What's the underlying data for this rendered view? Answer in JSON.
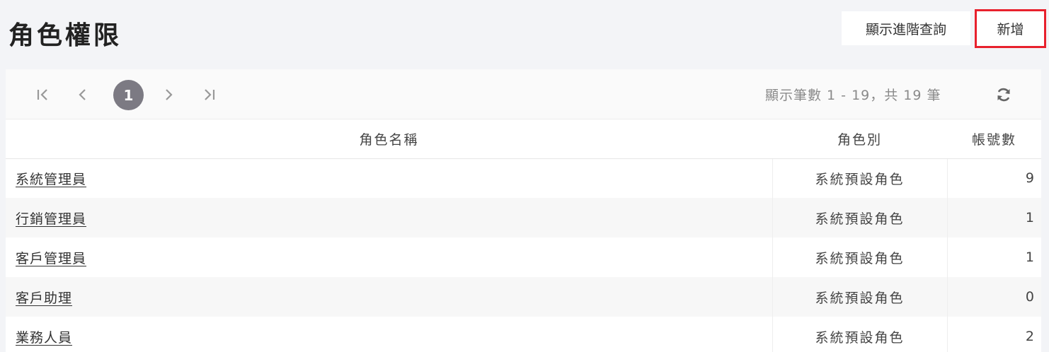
{
  "header": {
    "title": "角色權限",
    "advanced_search_label": "顯示進階查詢",
    "add_label": "新增"
  },
  "pagination": {
    "current_page": "1",
    "summary": "顯示筆數 1 - 19，共 19 筆"
  },
  "icons": {
    "first": "first-page-icon",
    "prev": "prev-page-icon",
    "next": "next-page-icon",
    "last": "last-page-icon",
    "refresh": "refresh-icon"
  },
  "table": {
    "headers": [
      "角色名稱",
      "角色別",
      "帳號數"
    ],
    "rows": [
      {
        "name": "系統管理員",
        "type": "系統預設角色",
        "count": "9"
      },
      {
        "name": "行銷管理員",
        "type": "系統預設角色",
        "count": "1"
      },
      {
        "name": "客戶管理員",
        "type": "系統預設角色",
        "count": "1"
      },
      {
        "name": "客戶助理",
        "type": "系統預設角色",
        "count": "0"
      },
      {
        "name": "業務人員",
        "type": "系統預設角色",
        "count": "2"
      }
    ]
  },
  "colors": {
    "add_button_outline": "#e8212d",
    "current_page_bg": "#7c7a83"
  }
}
